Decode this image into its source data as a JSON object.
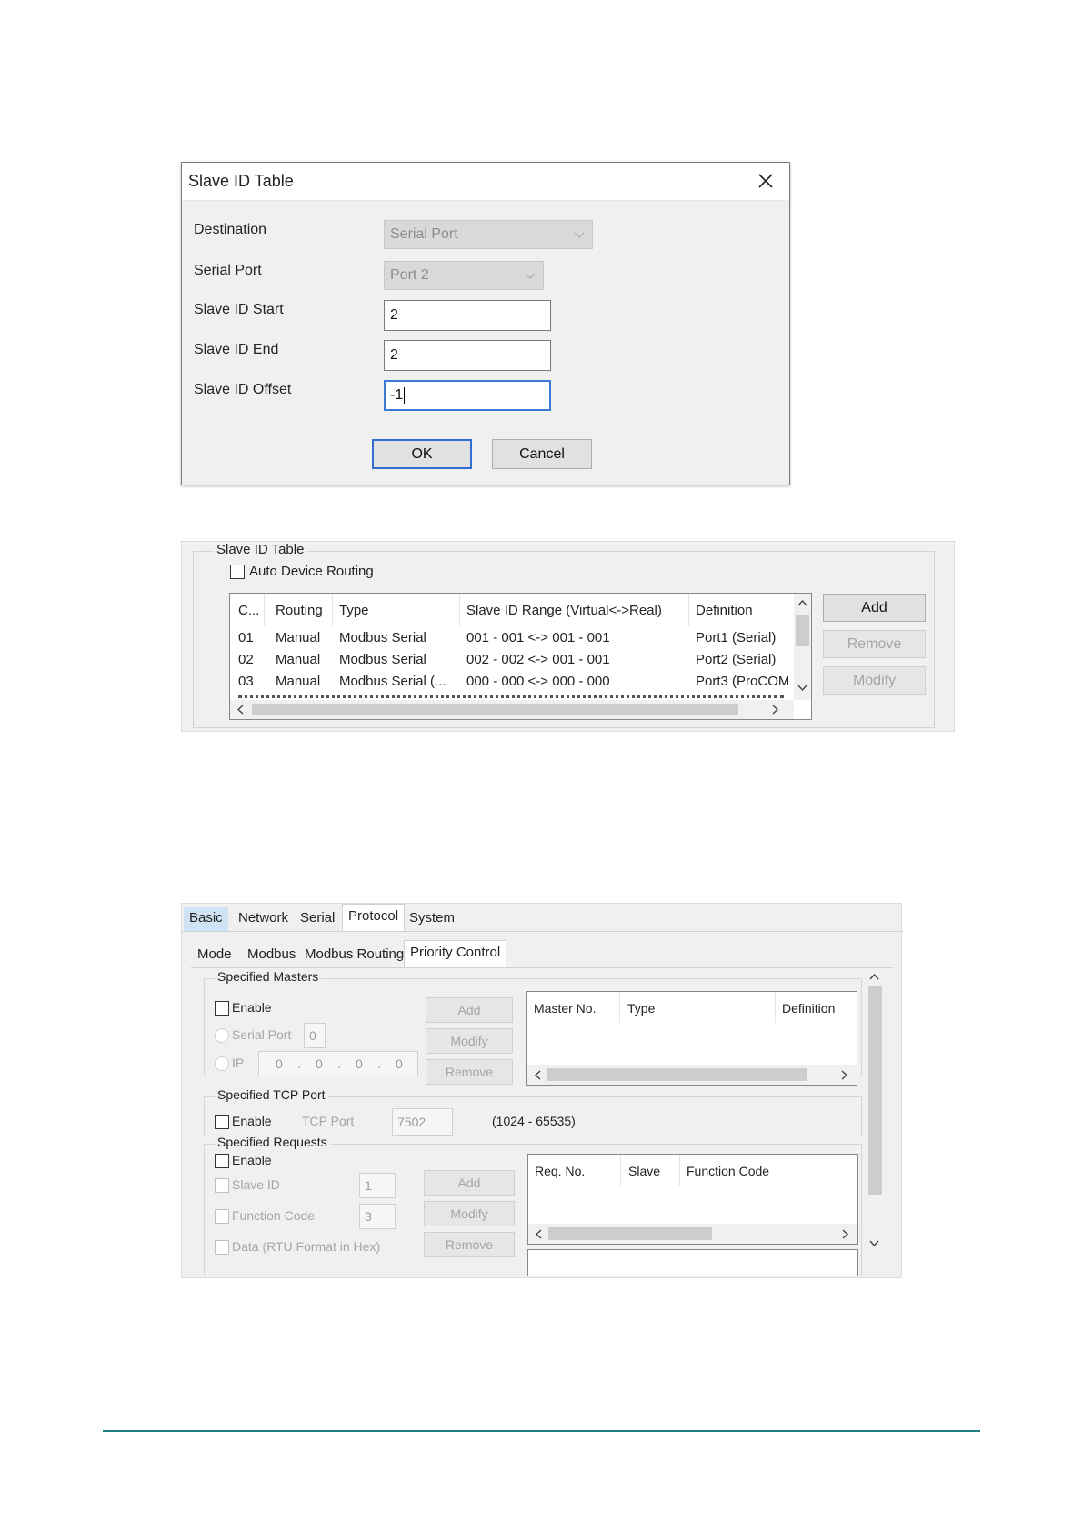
{
  "dialog": {
    "title": "Slave ID Table",
    "destination_label": "Destination",
    "destination_value": "Serial Port",
    "serial_port_label": "Serial Port",
    "serial_port_value": "Port 2",
    "slave_id_start_label": "Slave ID Start",
    "slave_id_start_value": "2",
    "slave_id_end_label": "Slave ID End",
    "slave_id_end_value": "2",
    "slave_id_offset_label": "Slave ID Offset",
    "slave_id_offset_value": "-1",
    "ok_label": "OK",
    "cancel_label": "Cancel"
  },
  "slave_table": {
    "group_title": "Slave ID Table",
    "auto_routing_label": "Auto Device Routing",
    "headers": [
      "C...",
      "Routing",
      "Type",
      "Slave ID Range (Virtual<->Real)",
      "Definition"
    ],
    "rows": [
      [
        "01",
        "Manual",
        "Modbus Serial",
        "001 - 001 <-> 001 - 001",
        "Port1 (Serial)"
      ],
      [
        "02",
        "Manual",
        "Modbus Serial",
        "002 - 002 <-> 001 - 001",
        "Port2 (Serial)"
      ],
      [
        "03",
        "Manual",
        "Modbus Serial (...",
        "000 - 000 <-> 000 - 000",
        "Port3 (ProCOM"
      ]
    ],
    "add_label": "Add",
    "remove_label": "Remove",
    "modify_label": "Modify"
  },
  "settings": {
    "main_tabs": [
      "Basic",
      "Network",
      "Serial",
      "Protocol",
      "System"
    ],
    "sub_tabs": [
      "Mode",
      "Modbus",
      "Modbus Routing",
      "Priority Control"
    ],
    "specified_masters": {
      "title": "Specified Masters",
      "enable_label": "Enable",
      "serial_port_label": "Serial Port",
      "serial_port_value": "0",
      "ip_label": "IP",
      "ip_octets": [
        "0",
        "0",
        "0",
        "0"
      ],
      "add_label": "Add",
      "modify_label": "Modify",
      "remove_label": "Remove",
      "headers": [
        "Master No.",
        "Type",
        "Definition"
      ]
    },
    "specified_tcp_port": {
      "title": "Specified TCP Port",
      "enable_label": "Enable",
      "tcp_port_label": "TCP Port",
      "tcp_port_value": "7502",
      "range_text": "(1024 - 65535)"
    },
    "specified_requests": {
      "title": "Specified Requests",
      "enable_label": "Enable",
      "slave_id_label": "Slave ID",
      "slave_id_value": "1",
      "function_code_label": "Function Code",
      "function_code_value": "3",
      "data_label": "Data (RTU Format in Hex)",
      "add_label": "Add",
      "modify_label": "Modify",
      "remove_label": "Remove",
      "headers": [
        "Req. No.",
        "Slave",
        "Function Code"
      ]
    }
  }
}
